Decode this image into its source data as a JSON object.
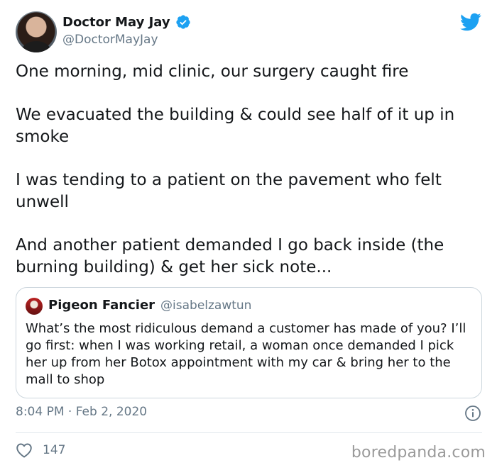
{
  "tweet": {
    "author_name": "Doctor May Jay",
    "author_handle": "@DoctorMayJay",
    "paragraphs": [
      "One morning, mid clinic, our surgery caught fire",
      "We evacuated the building & could see half of it up in smoke",
      "I was tending to a patient on the pavement who felt unwell",
      "And another patient demanded I go back inside (the burning building) & get her sick note..."
    ],
    "timestamp": "8:04 PM · Feb 2, 2020",
    "like_count": "147"
  },
  "quoted_tweet": {
    "author_name": "Pigeon Fancier",
    "author_handle": "@isabelzawtun",
    "text": "What’s the most ridiculous demand a customer has made of you? I’ll go first: when I was working retail, a woman once demanded I pick her up from her Botox appointment with my car & bring her to the mall to shop"
  },
  "watermark": "boredpanda.com",
  "icons": {
    "verified": "verified-badge-icon",
    "brand": "twitter-bird-icon",
    "info": "info-icon",
    "like": "heart-icon"
  },
  "colors": {
    "brand_blue": "#1da1f2",
    "text_primary": "#14171a",
    "text_secondary": "#657786",
    "border": "#ccd6dd"
  }
}
